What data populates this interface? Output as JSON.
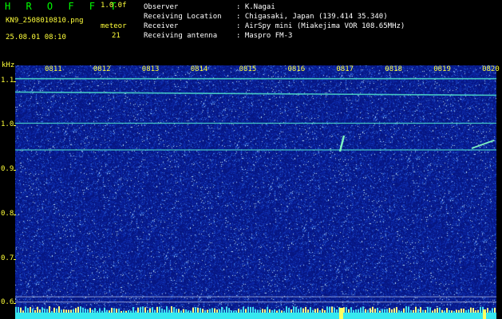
{
  "header": {
    "app_title": "H R O F F T",
    "version": "1.0.0f",
    "file_name": "KN9_2508010810.png",
    "meteor_label": "meteor",
    "datetime": "25.08.01 08:10",
    "meteor_count": "21"
  },
  "info": {
    "observer_label": "Observer",
    "observer_value": ": K.Nagai",
    "location_label": "Receiving Location",
    "location_value": ": Chigasaki, Japan (139.414 35.340)",
    "receiver_label": "Receiver",
    "receiver_value": ": AirSpy mini (Miakejima VOR 108.65MHz)",
    "antenna_label": "Receiving antenna",
    "antenna_value": ": Maspro FM-3"
  },
  "spectrogram": {
    "unit": "kHz",
    "y_ticks": [
      "1.1",
      "1.0",
      "0.9",
      "0.8",
      "0.7",
      "0.6"
    ],
    "x_ticks": [
      "0811",
      "0812",
      "0813",
      "0814",
      "0815",
      "0816",
      "0817",
      "0818",
      "0819",
      "0820"
    ],
    "ylim": [
      0.565,
      1.135
    ],
    "signal_lines_khz": [
      1.105,
      1.075,
      1.005,
      0.945,
      0.615,
      0.603
    ],
    "colors": {
      "background": "#071a8c",
      "signal": "#4cd8c8",
      "label": "#ffff3a",
      "baseline": "#35e8f0"
    }
  }
}
